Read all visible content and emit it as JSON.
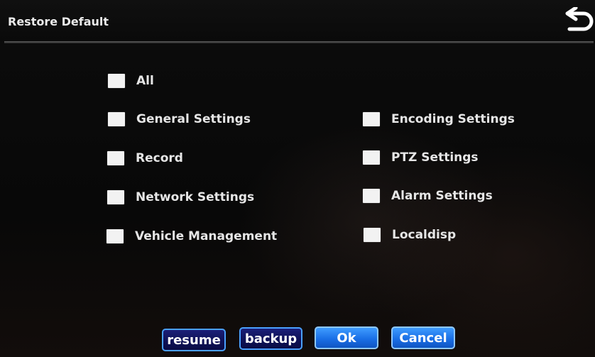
{
  "header": {
    "title": "Restore Default",
    "back_icon": "return-arrow-icon"
  },
  "options": {
    "all": "All",
    "general": "General Settings",
    "record": "Record",
    "network": "Network Settings",
    "vehicle": "Vehicle Management",
    "encoding": "Encoding Settings",
    "ptz": "PTZ Settings",
    "alarm": "Alarm Settings",
    "localdisp": "Localdisp"
  },
  "buttons": {
    "resume": "resume",
    "backup": "backup",
    "ok": "Ok",
    "cancel": "Cancel"
  },
  "colors": {
    "accent": "#4aa0ff",
    "button_dark": "#1b1f78",
    "button_light": "#3f9cff"
  }
}
